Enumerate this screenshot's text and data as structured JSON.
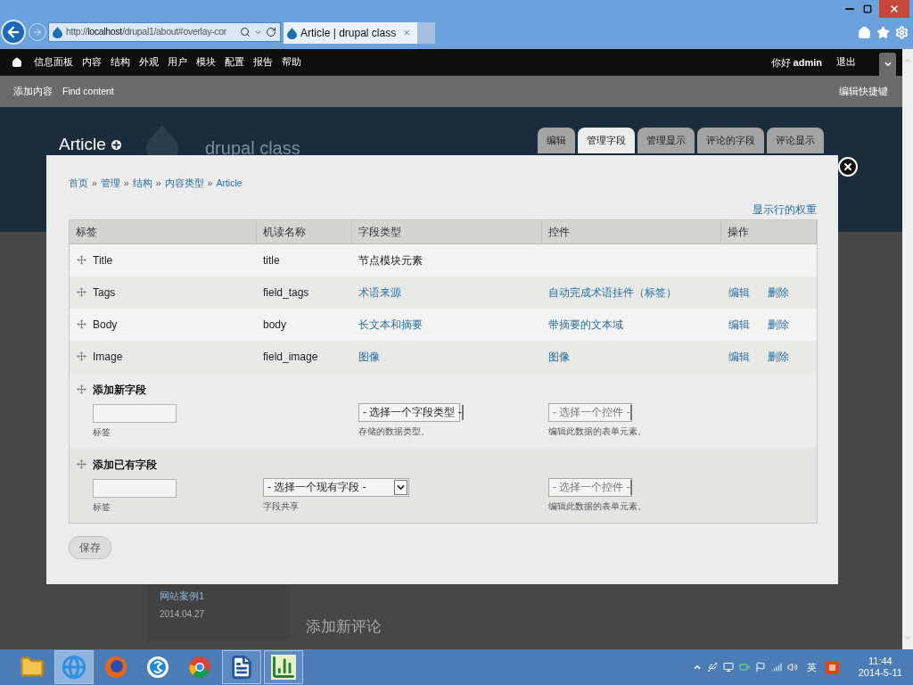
{
  "browser": {
    "address": "http://**localhost**/drupal1/about#overlay-cor",
    "tab_title": "Article | drupal class",
    "tab_close": "×"
  },
  "toolbar": {
    "menu": [
      "信息面板",
      "内容",
      "结构",
      "外观",
      "用户",
      "模块",
      "配置",
      "报告",
      "帮助"
    ],
    "greeting": "你好",
    "user": "admin",
    "logout": "退出"
  },
  "shortcuts": {
    "items": [
      "添加内容",
      "Find content"
    ],
    "edit": "编辑快捷键"
  },
  "page": {
    "title": "Article",
    "site_name": "drupal class",
    "tabs": [
      {
        "label": "编辑",
        "selected": false
      },
      {
        "label": "管理字段",
        "selected": true
      },
      {
        "label": "管理显示",
        "selected": false
      },
      {
        "label": "评论的字段",
        "selected": false
      },
      {
        "label": "评论显示",
        "selected": false
      }
    ],
    "sidebar_link": "网站案例1",
    "sidebar_date": "2014.04.27",
    "comment_heading": "添加新评论"
  },
  "modal": {
    "breadcrumb": [
      "首页",
      "管理",
      "结构",
      "内容类型",
      "Article"
    ],
    "separator": "»",
    "weights_link": "显示行的权重",
    "columns": [
      "标签",
      "机读名称",
      "字段类型",
      "控件",
      "操作"
    ],
    "rows": [
      {
        "kind": "base",
        "label": "Title",
        "machine_name": "title",
        "field_type": "节点模块元素"
      },
      {
        "kind": "field",
        "label": "Tags",
        "machine_name": "field_tags",
        "field_type": "术语来源",
        "widget": "自动完成术语挂件（标签）",
        "edit": "编辑",
        "delete": "删除"
      },
      {
        "kind": "field",
        "label": "Body",
        "machine_name": "body",
        "field_type": "长文本和摘要",
        "widget": "带摘要的文本域",
        "edit": "编辑",
        "delete": "删除"
      },
      {
        "kind": "field",
        "label": "Image",
        "machine_name": "field_image",
        "field_type": "图像",
        "widget": "图像",
        "edit": "编辑",
        "delete": "删除"
      }
    ],
    "add_new": {
      "title": "添加新字段",
      "label_hint": "标签",
      "type_select": "- 选择一个字段类型 -",
      "type_hint": "存储的数据类型。",
      "widget_select": "- 选择一个控件 -",
      "widget_hint": "编辑此数据的表单元素。"
    },
    "add_existing": {
      "title": "添加已有字段",
      "label_hint": "标签",
      "field_select": "- 选择一个现有字段 -",
      "field_hint": "字段共享",
      "widget_select": "- 选择一个控件 -",
      "widget_hint": "编辑此数据的表单元素。"
    },
    "save": "保存"
  },
  "taskbar": {
    "apps": [
      {
        "kind": "folder",
        "active": false,
        "running": false
      },
      {
        "kind": "ie",
        "active": true,
        "running": true
      },
      {
        "kind": "firefox",
        "active": false,
        "running": false
      },
      {
        "kind": "s",
        "active": false,
        "running": false
      },
      {
        "kind": "chrome",
        "active": false,
        "running": false
      },
      {
        "kind": "word",
        "active": false,
        "running": true
      },
      {
        "kind": "chart",
        "active": false,
        "running": true
      }
    ],
    "ime": "英",
    "time": "11:44",
    "date": "2014-5-11"
  }
}
